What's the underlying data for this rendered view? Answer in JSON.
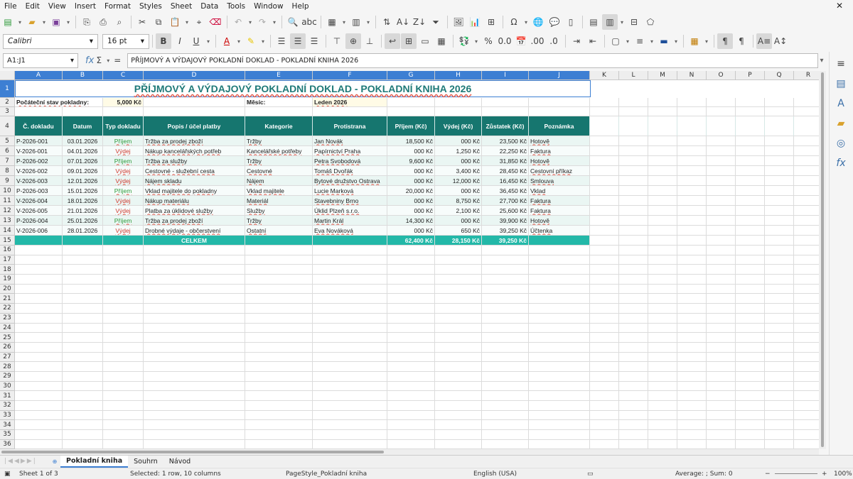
{
  "menu": [
    "File",
    "Edit",
    "View",
    "Insert",
    "Format",
    "Styles",
    "Sheet",
    "Data",
    "Tools",
    "Window",
    "Help"
  ],
  "toolbar": {
    "font": "Calibri",
    "size": "16 pt"
  },
  "formula": {
    "cell_ref": "A1:J1",
    "content": "PŘÍJMOVÝ A VÝDAJOVÝ POKLADNÍ DOKLAD - POKLADNÍ KNIHA 2026"
  },
  "columns": [
    "A",
    "B",
    "C",
    "D",
    "E",
    "F",
    "G",
    "H",
    "I",
    "J",
    "K",
    "L",
    "M",
    "N",
    "O",
    "P",
    "Q",
    "R"
  ],
  "rows": [
    "1",
    "2",
    "3",
    "4",
    "5",
    "6",
    "7",
    "8",
    "9",
    "10",
    "11",
    "12",
    "13",
    "14",
    "15",
    "16",
    "17",
    "18",
    "19",
    "20",
    "21",
    "22",
    "23",
    "24",
    "25",
    "26",
    "27",
    "28",
    "29",
    "30",
    "31",
    "32",
    "33",
    "34",
    "35",
    "36"
  ],
  "sheet": {
    "title": "PŘÍJMOVÝ A VÝDAJOVÝ POKLADNÍ DOKLAD - POKLADNÍ KNIHA 2026",
    "opening_label": "Počáteční stav pokladny:",
    "opening_value": "5,000 Kč",
    "month_label": "Měsíc:",
    "month_value": "Leden 2026",
    "headers": [
      "Č. dokladu",
      "Datum",
      "Typ dokladu",
      "Popis / účel platby",
      "Kategorie",
      "Protistrana",
      "Příjem (Kč)",
      "Výdej (Kč)",
      "Zůstatek (Kč)",
      "Poznámka"
    ],
    "records": [
      [
        "P-2026-001",
        "03.01.2026",
        "Příjem",
        "Tržba za prodej zboží",
        "Tržby",
        "Jan Novák",
        "18,500 Kč",
        "000 Kč",
        "23,500 Kč",
        "Hotově"
      ],
      [
        "V-2026-001",
        "04.01.2026",
        "Výdej",
        "Nákup kancelářských potřeb",
        "Kancelářské potřeby",
        "Papírnictví Praha",
        "000 Kč",
        "1,250 Kč",
        "22,250 Kč",
        "Faktura"
      ],
      [
        "P-2026-002",
        "07.01.2026",
        "Příjem",
        "Tržba za služby",
        "Tržby",
        "Petra Svobodová",
        "9,600 Kč",
        "000 Kč",
        "31,850 Kč",
        "Hotově"
      ],
      [
        "V-2026-002",
        "09.01.2026",
        "Výdej",
        "Cestovné - služební cesta",
        "Cestovné",
        "Tomáš Dvořák",
        "000 Kč",
        "3,400 Kč",
        "28,450 Kč",
        "Cestovní příkaz"
      ],
      [
        "V-2026-003",
        "12.01.2026",
        "Výdej",
        "Nájem skladu",
        "Nájem",
        "Bytové družstvo Ostrava",
        "000 Kč",
        "12,000 Kč",
        "16,450 Kč",
        "Smlouva"
      ],
      [
        "P-2026-003",
        "15.01.2026",
        "Příjem",
        "Vklad majitele do pokladny",
        "Vklad majitele",
        "Lucie Marková",
        "20,000 Kč",
        "000 Kč",
        "36,450 Kč",
        "Vklad"
      ],
      [
        "V-2026-004",
        "18.01.2026",
        "Výdej",
        "Nákup materiálu",
        "Materiál",
        "Stavebniny Brno",
        "000 Kč",
        "8,750 Kč",
        "27,700 Kč",
        "Faktura"
      ],
      [
        "V-2026-005",
        "21.01.2026",
        "Výdej",
        "Platba za úklidové služby",
        "Služby",
        "Úklid Plzeň s.r.o.",
        "000 Kč",
        "2,100 Kč",
        "25,600 Kč",
        "Faktura"
      ],
      [
        "P-2026-004",
        "25.01.2026",
        "Příjem",
        "Tržba za prodej zboží",
        "Tržby",
        "Martin Král",
        "14,300 Kč",
        "000 Kč",
        "39,900 Kč",
        "Hotově"
      ],
      [
        "V-2026-006",
        "28.01.2026",
        "Výdej",
        "Drobné výdaje - občerstvení",
        "Ostatní",
        "Eva Nováková",
        "000 Kč",
        "650 Kč",
        "39,250 Kč",
        "Účtenka"
      ]
    ],
    "total_label": "CELKEM",
    "total_income": "62,400 Kč",
    "total_expense": "28,150 Kč",
    "total_balance": "39,250 Kč"
  },
  "tabs": [
    "Pokladní kniha",
    "Souhrn",
    "Návod"
  ],
  "status": {
    "sheet": "Sheet 1 of 3",
    "selection": "Selected: 1 row, 10 columns",
    "pagestyle": "PageStyle_Pokladní kniha",
    "lang": "English (USA)",
    "sum": "Average: ; Sum: 0",
    "zoom": "100%"
  }
}
